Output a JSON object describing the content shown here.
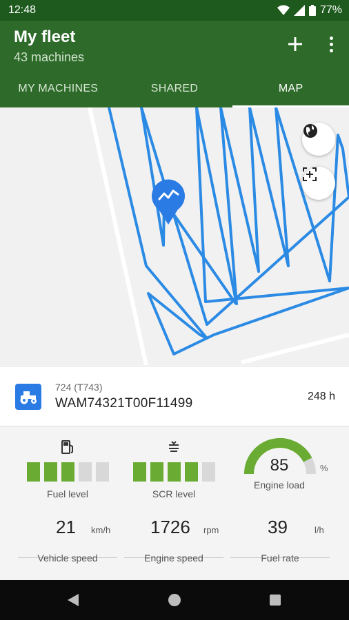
{
  "status": {
    "time": "12:48",
    "battery": "77%"
  },
  "header": {
    "title": "My fleet",
    "subtitle": "43 machines"
  },
  "tabs": [
    {
      "label": "MY MACHINES",
      "active": false
    },
    {
      "label": "SHARED",
      "active": false
    },
    {
      "label": "MAP",
      "active": true
    }
  ],
  "map": {
    "route_color": "#2b8ae4",
    "marker_icon": "activity-icon",
    "buttons": [
      "globe-icon",
      "recenter-icon"
    ]
  },
  "machine": {
    "name": "724 (T743)",
    "serial": "WAM74321T00F11499",
    "hours": "248 h",
    "icon": "tractor-icon"
  },
  "gauges": {
    "fuel": {
      "label": "Fuel level",
      "icon": "fuel-pump-icon",
      "segments_total": 5,
      "segments_on": 3
    },
    "scr": {
      "label": "SCR level",
      "icon": "scr-tank-icon",
      "segments_total": 5,
      "segments_on": 4
    },
    "engine_load": {
      "label": "Engine load",
      "value": "85",
      "unit": "%",
      "fraction": 0.85
    }
  },
  "stats": [
    {
      "value": "21",
      "unit": "km/h",
      "label": "Vehicle speed"
    },
    {
      "value": "1726",
      "unit": "rpm",
      "label": "Engine speed"
    },
    {
      "value": "39",
      "unit": "l/h",
      "label": "Fuel rate"
    }
  ],
  "colors": {
    "appbar": "#2e6b2a",
    "statusbar": "#1e5a1e",
    "segment_on": "#6aab33",
    "segment_off": "#d8d8d8",
    "accent": "#2a7be4"
  }
}
